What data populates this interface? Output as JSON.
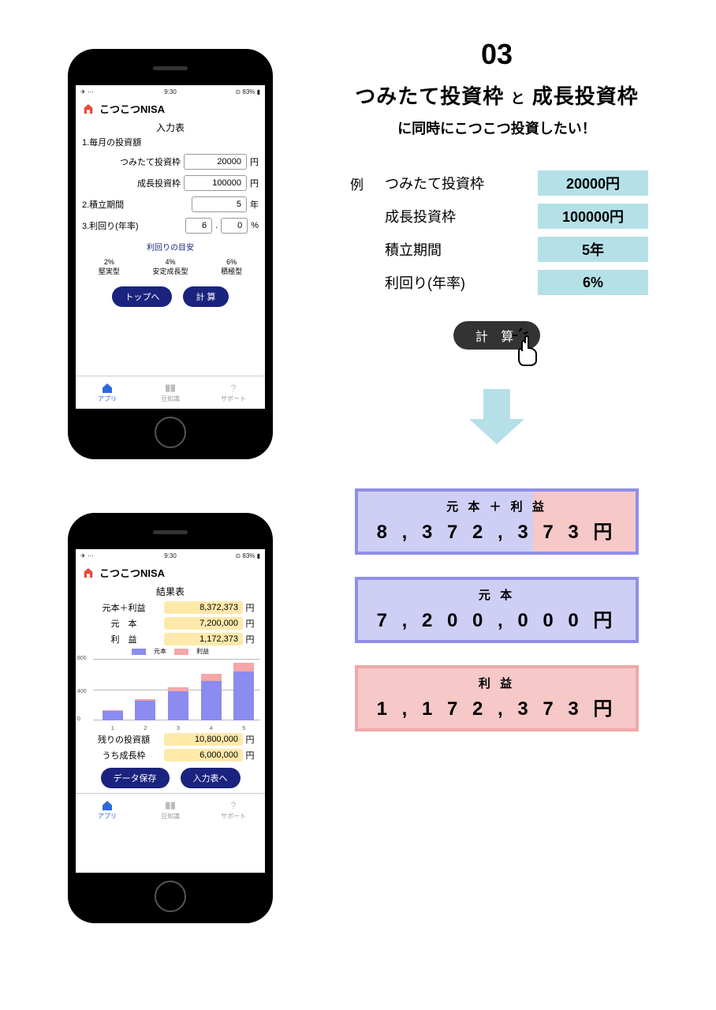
{
  "page": {
    "number": "03",
    "headline_a": "つみたて投資枠",
    "headline_joiner": "と",
    "headline_b": "成長投資枠",
    "subline": "に同時にこつこつ投資したい！"
  },
  "status_bar": {
    "left": "✈ ⋯",
    "time": "9:30",
    "right": "⊙ 83% ▮"
  },
  "app": {
    "name": "こつこつNISA",
    "input_title": "入力表",
    "q1": "1.毎月の投資額",
    "tsumitate_label": "つみたて投資枠",
    "tsumitate_value": "20000",
    "yen": "円",
    "growth_label": "成長投資枠",
    "growth_value": "100000",
    "q2": "2.積立期間",
    "period_value": "5",
    "year": "年",
    "q3": "3.利回り(年率)",
    "yield_int": "6",
    "yield_dec": "0",
    "percent": "%",
    "hint_title": "利回りの目安",
    "hint1_pct": "2%",
    "hint1_name": "堅実型",
    "hint2_pct": "4%",
    "hint2_name": "安定成長型",
    "hint3_pct": "6%",
    "hint3_name": "積極型",
    "btn_top": "トップへ",
    "btn_calc": "計 算",
    "result_title": "結果表",
    "res_total_label": "元本＋利益",
    "res_total_value": "8,372,373",
    "res_principal_label": "元　本",
    "res_principal_value": "7,200,000",
    "res_profit_label": "利　益",
    "res_profit_value": "1,172,373",
    "legend_blue": "元本",
    "legend_pink": "利益",
    "remaining_label": "残りの投資額",
    "remaining_value": "10,800,000",
    "remaining_growth_label": "うち成長枠",
    "remaining_growth_value": "6,000,000",
    "btn_save": "データ保存",
    "btn_back": "入力表へ",
    "tab1": "アプリ",
    "tab2": "豆知識",
    "tab3": "サポート"
  },
  "example": {
    "marker": "例",
    "row1_label": "つみたて投資枠",
    "row1_value": "20000円",
    "row2_label": "成長投資枠",
    "row2_value": "100000円",
    "row3_label": "積立期間",
    "row3_value": "5年",
    "row4_label": "利回り(年率)",
    "row4_value": "6%",
    "calc_label": "計 算"
  },
  "cards": {
    "total_title": "元 本 ＋ 利 益",
    "total_value": "8 , 3 7 2 , 3 7 3  円",
    "principal_title": "元 本",
    "principal_value": "7 , 2 0 0 , 0 0 0  円",
    "profit_title": "利 益",
    "profit_value": "1 , 1 7 2 , 3 7 3 円"
  },
  "chart_data": {
    "type": "bar",
    "title": "",
    "xlabel": "",
    "ylabel": "",
    "ylim": [
      0,
      900
    ],
    "yticks": [
      0,
      400,
      800
    ],
    "categories": [
      "1",
      "2",
      "3",
      "4",
      "5"
    ],
    "series": [
      {
        "name": "元本",
        "values": [
          144,
          288,
          432,
          576,
          720
        ],
        "color": "#8b8bf0"
      },
      {
        "name": "利益",
        "values": [
          5,
          22,
          50,
          100,
          117
        ],
        "color": "#f5a6a6"
      }
    ]
  }
}
